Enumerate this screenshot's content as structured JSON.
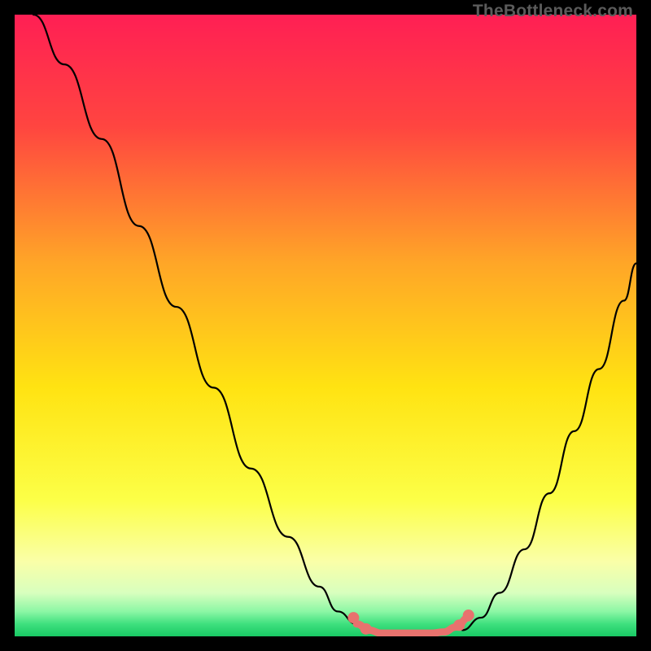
{
  "watermark": "TheBottleneck.com",
  "chart_data": {
    "type": "line",
    "title": "",
    "xlabel": "",
    "ylabel": "",
    "xlim": [
      0,
      100
    ],
    "ylim": [
      0,
      100
    ],
    "background_gradient_stops": [
      {
        "pct": 0,
        "color": "#ff1f54"
      },
      {
        "pct": 18,
        "color": "#ff4540"
      },
      {
        "pct": 40,
        "color": "#ffa627"
      },
      {
        "pct": 60,
        "color": "#ffe312"
      },
      {
        "pct": 78,
        "color": "#fcff47"
      },
      {
        "pct": 88,
        "color": "#faffa8"
      },
      {
        "pct": 93,
        "color": "#d8ffbe"
      },
      {
        "pct": 96,
        "color": "#8cf7a5"
      },
      {
        "pct": 98,
        "color": "#3fe07e"
      },
      {
        "pct": 100,
        "color": "#18c964"
      }
    ],
    "series": [
      {
        "name": "left-curve",
        "stroke": "#000000",
        "x": [
          3,
          8,
          14,
          20,
          26,
          32,
          38,
          44,
          49,
          52,
          55,
          57
        ],
        "y": [
          100,
          92,
          80,
          66,
          53,
          40,
          27,
          16,
          8,
          4,
          2,
          1
        ]
      },
      {
        "name": "right-curve",
        "stroke": "#000000",
        "x": [
          72,
          75,
          78,
          82,
          86,
          90,
          94,
          98,
          100
        ],
        "y": [
          1,
          3,
          7,
          14,
          23,
          33,
          43,
          54,
          60
        ]
      },
      {
        "name": "floor-band",
        "stroke": "#e8726e",
        "stroke_width": 9,
        "x": [
          55,
          57,
          59,
          61,
          63,
          65,
          67,
          69,
          71,
          73
        ],
        "y": [
          2,
          1,
          0.5,
          0.5,
          0.5,
          0.5,
          0.5,
          0.7,
          1.5,
          3
        ]
      }
    ],
    "dots": {
      "name": "floor-band-dots",
      "fill": "#e8726e",
      "r": 7,
      "points": [
        {
          "x": 54.5,
          "y": 3.0
        },
        {
          "x": 56.5,
          "y": 1.2
        },
        {
          "x": 71.5,
          "y": 1.8
        },
        {
          "x": 73.0,
          "y": 3.4
        }
      ]
    }
  }
}
